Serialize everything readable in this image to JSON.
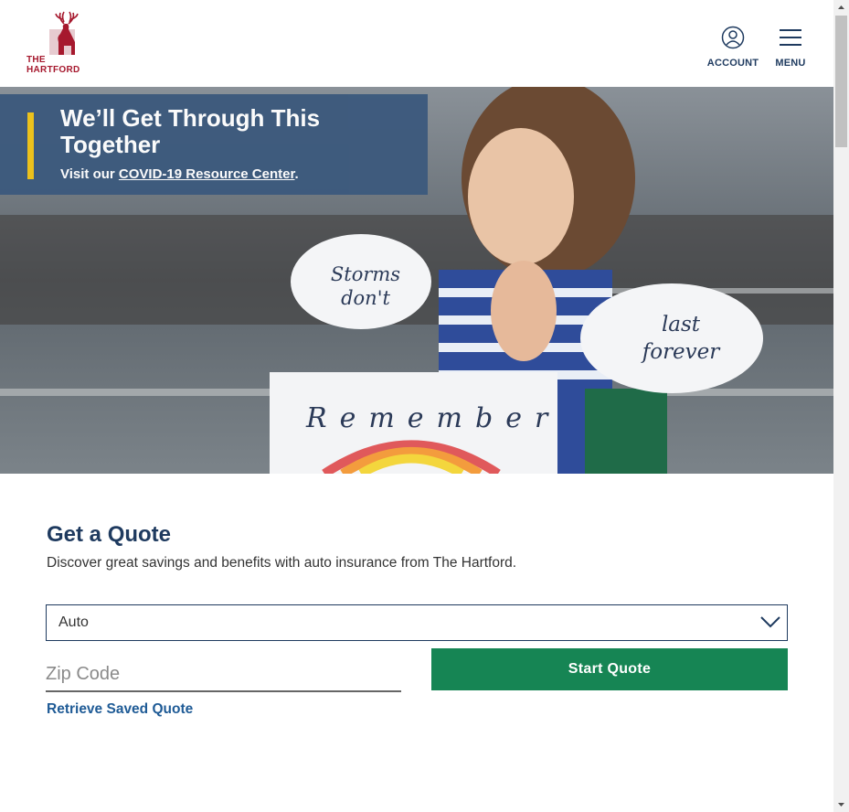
{
  "brand": {
    "name_line1": "THE",
    "name_line2": "HARTFORD"
  },
  "header": {
    "account_label": "ACCOUNT",
    "menu_label": "MENU"
  },
  "hero": {
    "headline": "We’ll Get Through This Together",
    "visit_prefix": "Visit our ",
    "resource_link": "COVID-19 Resource Center",
    "visit_suffix": ".",
    "sign1": "Storms don't",
    "sign2": "last forever",
    "sign3": "Remember"
  },
  "quote": {
    "title": "Get a Quote",
    "subtitle": "Discover great savings and benefits with auto insurance from The Hartford.",
    "product_selected": "Auto",
    "zip_placeholder": "Zip Code",
    "start_label": "Start Quote",
    "retrieve_label": "Retrieve Saved Quote"
  },
  "colors": {
    "brand_red": "#a6192e",
    "navy": "#1e3a5f",
    "banner_bg": "#3d5a7d",
    "accent_yellow": "#f0c419",
    "cta_green": "#168554",
    "link_blue": "#1f5b96"
  }
}
